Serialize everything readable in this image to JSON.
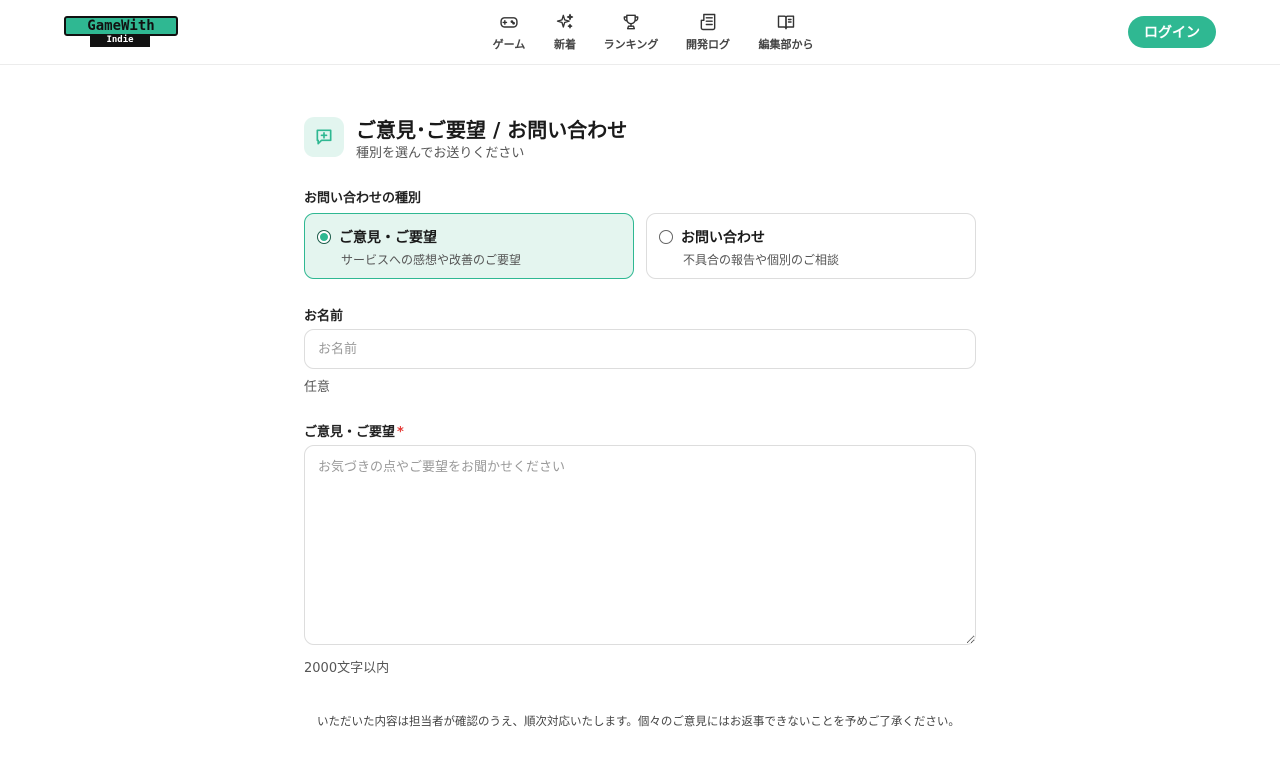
{
  "header": {
    "logo_text": "GameWith",
    "logo_sub": "Indie",
    "nav": [
      {
        "label": "ゲーム",
        "icon": "gamepad-icon"
      },
      {
        "label": "新着",
        "icon": "sparkles-icon"
      },
      {
        "label": "ランキング",
        "icon": "trophy-icon"
      },
      {
        "label": "開発ログ",
        "icon": "newspaper-icon"
      },
      {
        "label": "編集部から",
        "icon": "book-open-icon"
      }
    ],
    "login_label": "ログイン"
  },
  "page": {
    "title": "ご意見･ご要望 / お問い合わせ",
    "subtitle": "種別を選んでお送りください",
    "title_icon": "message-plus-icon"
  },
  "form": {
    "type_label": "お問い合わせの種別",
    "types": [
      {
        "title": "ご意見・ご要望",
        "desc": "サービスへの感想や改善のご要望",
        "selected": true
      },
      {
        "title": "お問い合わせ",
        "desc": "不具合の報告や個別のご相談",
        "selected": false
      }
    ],
    "name_label": "お名前",
    "name_placeholder": "お名前",
    "name_value": "",
    "name_hint": "任意",
    "message_label": "ご意見・ご要望",
    "required_mark": "*",
    "message_placeholder": "お気づきの点やご要望をお聞かせください",
    "message_value": "",
    "message_hint": "2000文字以内",
    "notice": "いただいた内容は担当者が確認のうえ、順次対応いたします。個々のご意見にはお返事できないことを予めご了承ください。"
  },
  "colors": {
    "accent": "#2fb892",
    "accent_light": "#e4f5ef",
    "required": "#e53935"
  }
}
